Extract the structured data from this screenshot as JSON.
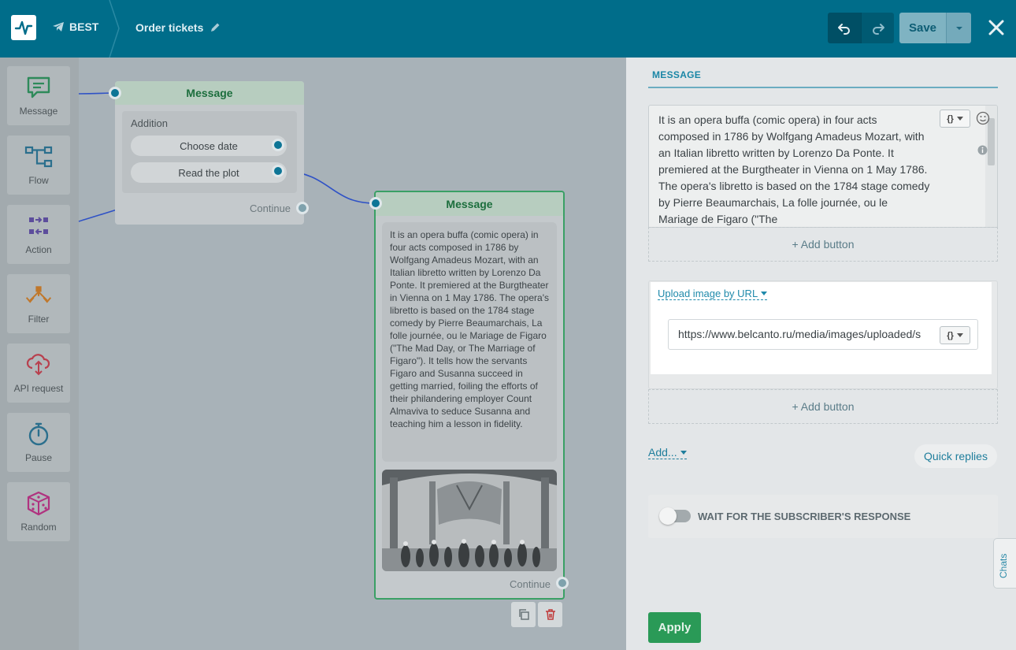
{
  "header": {
    "bot_name": "BEST",
    "flow_name": "Order tickets",
    "save_label": "Save"
  },
  "palette": [
    {
      "label": "Message",
      "icon": "message-icon",
      "color": "#2e8a5a"
    },
    {
      "label": "Flow",
      "icon": "flow-icon",
      "color": "#2b6f8d"
    },
    {
      "label": "Action",
      "icon": "action-icon",
      "color": "#5c4d9c"
    },
    {
      "label": "Filter",
      "icon": "filter-icon",
      "color": "#c0772a"
    },
    {
      "label": "API request",
      "icon": "api-cloud-icon",
      "color": "#b8404e"
    },
    {
      "label": "Pause",
      "icon": "stopwatch-icon",
      "color": "#2b6f8d"
    },
    {
      "label": "Random",
      "icon": "dice-icon",
      "color": "#b0327f"
    }
  ],
  "node1": {
    "title": "Message",
    "section": "Addition",
    "buttons": [
      "Choose date",
      "Read the plot"
    ],
    "continue": "Continue"
  },
  "node2": {
    "title": "Message",
    "text": "It is an opera buffa (comic opera) in four acts composed in 1786 by Wolfgang Amadeus Mozart, with an Italian libretto written by Lorenzo Da Ponte. It premiered at the Burgtheater in Vienna on 1 May 1786. The opera's libretto is based on the 1784 stage comedy by Pierre Beaumarchais, La folle journée, ou le Mariage de Figaro (\"The Mad Day, or The Marriage of Figaro\"). It tells how the servants Figaro and Susanna succeed in getting married, foiling the efforts of their philandering employer Count Almaviva to seduce Susanna and teaching him a lesson in fidelity.",
    "continue": "Continue"
  },
  "panel": {
    "section_title": "MESSAGE",
    "message_text": "It is an opera buffa (comic opera) in four acts composed in 1786 by Wolfgang Amadeus Mozart, with an Italian libretto written by Lorenzo Da Ponte. It premiered at the Burgtheater in Vienna on 1 May 1786. The opera's libretto is based on the 1784 stage comedy by Pierre Beaumarchais, La folle journée, ou le Mariage de Figaro (\"The",
    "add_button_1": "+ Add button",
    "upload_label": "Upload image by URL",
    "image_url": "https://www.belcanto.ru/media/images/uploaded/s",
    "add_button_2": "+ Add button",
    "add_label": "Add...",
    "quick_replies": "Quick replies",
    "wait_label": "WAIT FOR THE SUBSCRIBER'S RESPONSE",
    "apply_label": "Apply",
    "chats_label": "Chats",
    "var_symbol": "{}"
  }
}
